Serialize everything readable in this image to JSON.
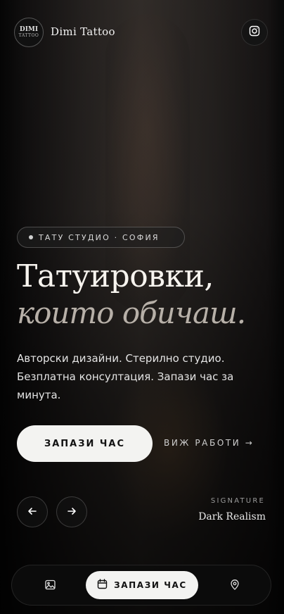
{
  "header": {
    "logo_line1": "DIMI",
    "logo_line2": "TATTOO",
    "brand_name": "Dimi Tattoo",
    "instagram_icon": "instagram-icon"
  },
  "hero": {
    "tag": "ТАТУ СТУДИО · СОФИЯ",
    "headline_line1": "Татуировки,",
    "headline_line2": "които обичаш.",
    "subtext": "Авторски дизайни. Стерилно студио. Безплатна консултация. Запази час за минута.",
    "cta_label": "ЗАПАЗИ ЧАС",
    "secondary_link": "ВИЖ РАБОТИ →",
    "signature_label": "SIGNATURE",
    "signature_value": "Dark Realism"
  },
  "carousel": {
    "prev_icon": "arrow-left-icon",
    "next_icon": "arrow-right-icon"
  },
  "bottom_nav": {
    "gallery_icon": "image-icon",
    "book_label": "ЗАПАЗИ ЧАС",
    "book_icon": "calendar-icon",
    "location_icon": "location-pin-icon"
  },
  "colors": {
    "background": "#0b0b0b",
    "button_light": "#f3f3f1",
    "accent_muted": "#b7b0a8"
  }
}
